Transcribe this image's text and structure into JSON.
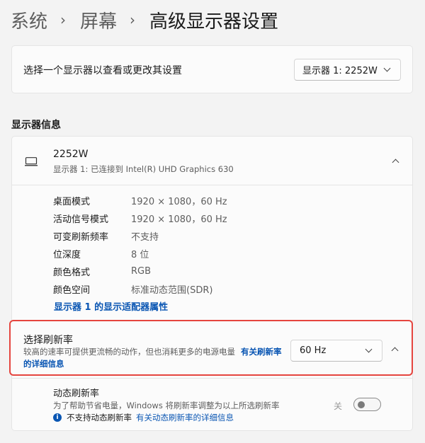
{
  "breadcrumb": {
    "items": [
      "系统",
      "屏幕",
      "高级显示器设置"
    ],
    "separator": "›"
  },
  "display_select": {
    "label": "选择一个显示器以查看或更改其设置",
    "selected": "显示器 1: 2252W"
  },
  "display_info": {
    "section_title": "显示器信息",
    "monitor_name": "2252W",
    "monitor_subtitle": "显示器 1: 已连接到 Intel(R) UHD Graphics 630",
    "properties": [
      {
        "key": "桌面模式",
        "value": "1920 × 1080，60 Hz"
      },
      {
        "key": "活动信号模式",
        "value": "1920 × 1080，60 Hz"
      },
      {
        "key": "可变刷新频率",
        "value": "不支持"
      },
      {
        "key": "位深度",
        "value": "8 位"
      },
      {
        "key": "颜色格式",
        "value": "RGB"
      },
      {
        "key": "颜色空间",
        "value": "标准动态范围(SDR)"
      }
    ],
    "adapter_link": "显示器 1 的显示适配器属性"
  },
  "refresh_rate": {
    "title": "选择刷新率",
    "description": "较高的速率可提供更流畅的动作，但也消耗更多的电源电量",
    "link": "有关刷新率的详细信息",
    "selected": "60 Hz"
  },
  "dynamic_refresh": {
    "title": "动态刷新率",
    "description": "为了帮助节省电量，Windows 将刷新率调整为以上所选刷新率",
    "note_icon": "i",
    "note_text": "不支持动态刷新率",
    "note_link": "有关动态刷新率的详细信息",
    "toggle_label": "关",
    "toggle_on": false
  },
  "colors": {
    "background": "#f3f3f3",
    "card": "#fbfbfb",
    "link": "#0a56b3",
    "highlight_border": "#e5453f"
  }
}
